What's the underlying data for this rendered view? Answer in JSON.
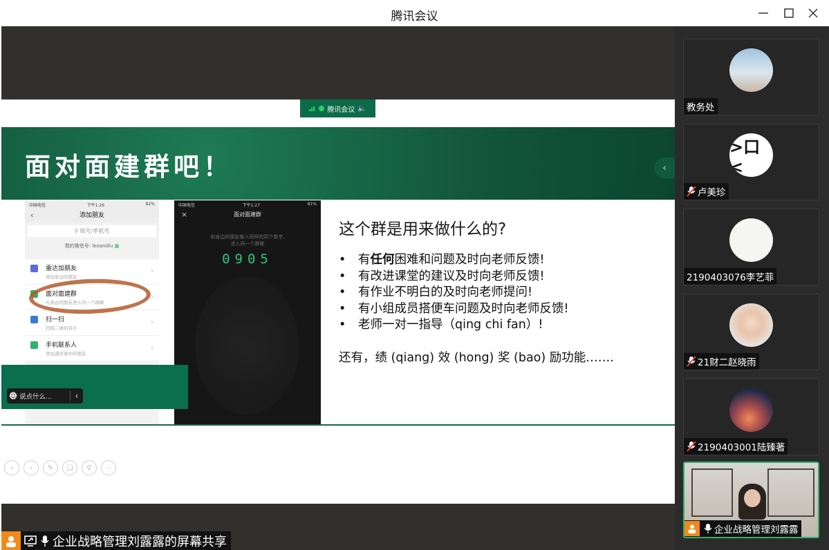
{
  "window": {
    "title": "腾讯会议"
  },
  "share": {
    "badge_label": "腾讯会议",
    "slide": {
      "title": "面对面建群吧！",
      "question": "这个群是用来做什么的?",
      "bullets": [
        {
          "pre": "有",
          "bold": "任何",
          "post": "困难和问题及时向老师反馈!"
        },
        {
          "pre": "有改进课堂的建议及时向老师反馈!",
          "bold": "",
          "post": ""
        },
        {
          "pre": "有作业不明白的及时向老师提问!",
          "bold": "",
          "post": ""
        },
        {
          "pre": "有小组成员搭便车问题及时向老师反馈!",
          "bold": "",
          "post": ""
        },
        {
          "pre": "老师一对一指导（qing chi fan）!",
          "bold": "",
          "post": ""
        }
      ],
      "footer": "还有，绩 (qiang) 效 (hong) 奖 (bao) 励功能……."
    },
    "phone1": {
      "status_left": "中国电信",
      "status_time": "下午1:26",
      "status_right": "82%",
      "header": "添加朋友",
      "search_placeholder": "账号/手机号",
      "wxid": "我的微信号: leoandlu",
      "items": [
        {
          "title": "雷达加朋友",
          "sub": "添加身边的朋友"
        },
        {
          "title": "面对面建群",
          "sub": "与身边的朋友进入同一个群聊"
        },
        {
          "title": "扫一扫",
          "sub": "扫描二维码名片"
        },
        {
          "title": "手机联系人",
          "sub": "添加通讯录中的朋友"
        }
      ]
    },
    "phone2": {
      "status_left": "中国电信",
      "status_time": "下午1:27",
      "status_right": "81%",
      "header": "面对面建群",
      "hint_line1": "和身边的朋友输入同样的四个数字,",
      "hint_line2": "进入同一个群聊",
      "code": "0905"
    },
    "chat_placeholder": "说点什么...",
    "presenter_label": "企业战略管理刘露露的屏幕共享"
  },
  "participants": [
    {
      "name": "教务处",
      "muted": false
    },
    {
      "name": "卢美珍",
      "muted": true
    },
    {
      "name": "2190403076李艺菲",
      "muted": false
    },
    {
      "name": "21财二赵晓雨",
      "muted": true
    },
    {
      "name": "2190403001陆臻著",
      "muted": true
    },
    {
      "name": "企业战略管理刘露露",
      "muted": false,
      "active": true
    }
  ],
  "colors": {
    "brand_green": "#0d6b4a",
    "active_border": "#2fb26a",
    "muted_red": "#e0433a",
    "presenter_orange": "#f08a1c"
  }
}
